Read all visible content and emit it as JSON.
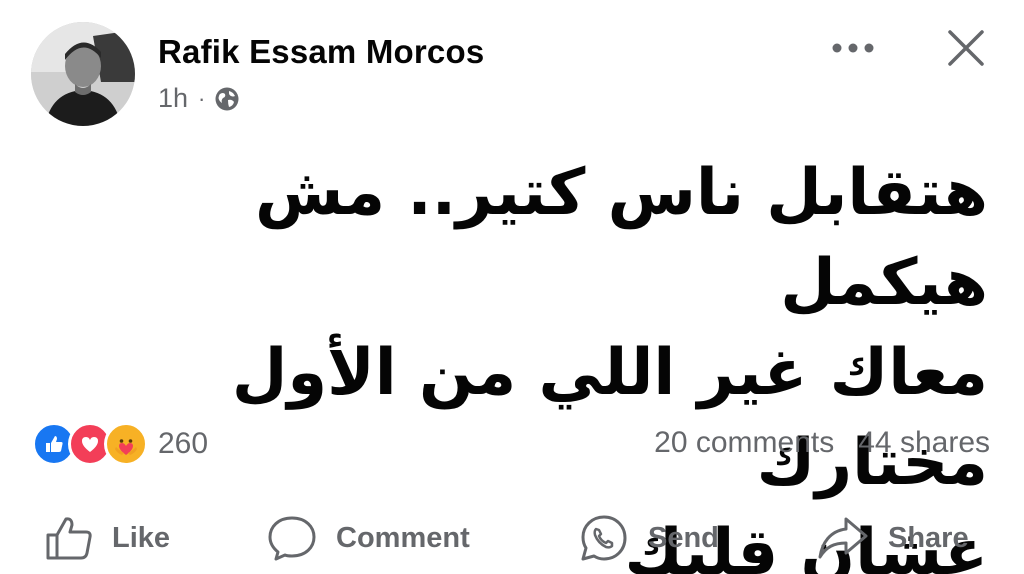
{
  "post": {
    "author": "Rafik Essam Morcos",
    "time": "1h",
    "separator": "·",
    "audience_icon": "globe-icon",
    "text": "هتقابل ناس كتير.. مش هيكمل\nمعاك غير اللي من الأول مختارك\nعشان قلبك"
  },
  "header": {
    "more_icon": "more-horizontal-icon",
    "close_icon": "close-icon"
  },
  "reactions": {
    "types": [
      "like-reaction-icon",
      "love-reaction-icon",
      "care-reaction-icon"
    ],
    "count": "260"
  },
  "engagement": {
    "comments": "20 comments",
    "shares": "44 shares"
  },
  "actions": {
    "like": "Like",
    "comment": "Comment",
    "send": "Send",
    "share": "Share"
  },
  "colors": {
    "primary_text": "#050505",
    "secondary_text": "#65676b",
    "like_blue": "#1877f2",
    "love_red": "#f33e58",
    "care_yellow": "#f7b125"
  }
}
